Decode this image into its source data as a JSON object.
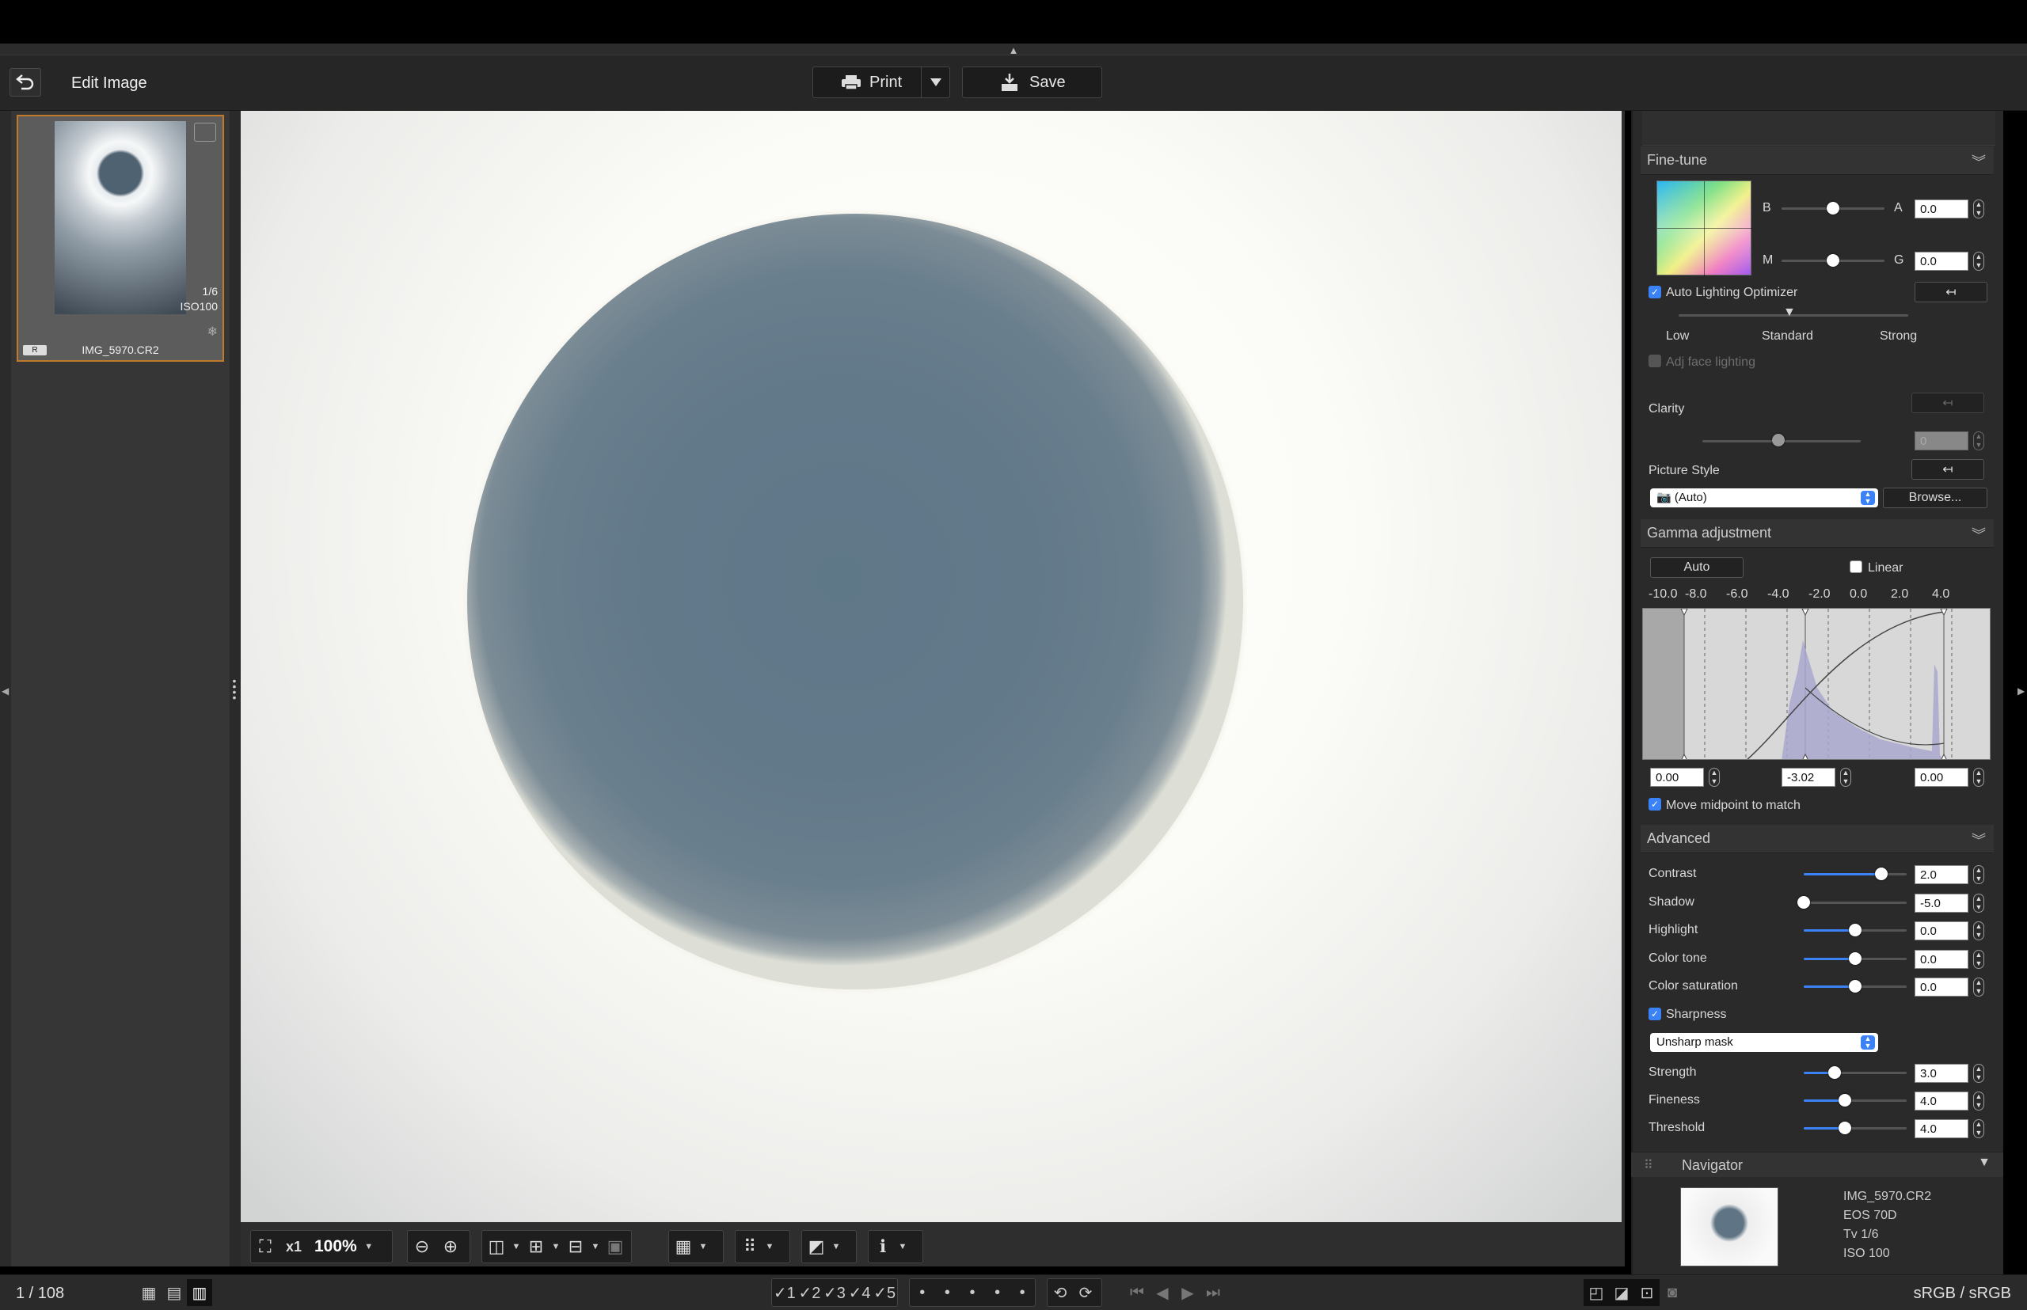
{
  "window": {
    "title": "Edit Image"
  },
  "toolbar": {
    "print_label": "Print",
    "save_label": "Save"
  },
  "thumbnail": {
    "filename": "IMG_5970.CR2",
    "shutter": "1/6",
    "iso": "ISO100",
    "badge": "R"
  },
  "image_toolbar": {
    "zoom": "100%",
    "x1_label": "x1"
  },
  "fine_tune": {
    "header": "Fine-tune",
    "b_label": "B",
    "a_label": "A",
    "a_value": "0.0",
    "m_label": "M",
    "g_label": "G",
    "g_value": "0.0",
    "auto_lighting_label": "Auto Lighting Optimizer",
    "auto_lighting_checked": true,
    "alo_low": "Low",
    "alo_standard": "Standard",
    "alo_strong": "Strong",
    "adj_face_label": "Adj face lighting",
    "clarity_label": "Clarity",
    "clarity_value": "0",
    "picture_style_label": "Picture Style",
    "picture_style_value": "(Auto)",
    "browse_label": "Browse..."
  },
  "gamma": {
    "header": "Gamma adjustment",
    "auto_label": "Auto",
    "linear_label": "Linear",
    "linear_checked": false,
    "ticks": [
      "-10.0",
      "-8.0",
      "-6.0",
      "-4.0",
      "-2.0",
      "0.0",
      "2.0",
      "4.0"
    ],
    "black_value": "0.00",
    "mid_value": "-3.02",
    "white_value": "0.00",
    "move_midpoint_label": "Move midpoint to match",
    "move_midpoint_checked": true
  },
  "advanced": {
    "header": "Advanced",
    "rows": [
      {
        "label": "Contrast",
        "value": "2.0",
        "level": 0.75
      },
      {
        "label": "Shadow",
        "value": "-5.0",
        "level": 0.0
      },
      {
        "label": "Highlight",
        "value": "0.0",
        "level": 0.5
      },
      {
        "label": "Color tone",
        "value": "0.0",
        "level": 0.5
      },
      {
        "label": "Color saturation",
        "value": "0.0",
        "level": 0.5
      }
    ],
    "sharpness_label": "Sharpness",
    "sharpness_checked": true,
    "sharpness_mode": "Unsharp mask",
    "sharp_rows": [
      {
        "label": "Strength",
        "value": "3.0",
        "level": 0.3
      },
      {
        "label": "Fineness",
        "value": "4.0",
        "level": 0.4
      },
      {
        "label": "Threshold",
        "value": "4.0",
        "level": 0.4
      }
    ]
  },
  "navigator": {
    "header": "Navigator",
    "filename": "IMG_5970.CR2",
    "camera": "EOS 70D",
    "tv": "Tv 1/6",
    "iso": "ISO 100"
  },
  "status": {
    "count": "1 / 108",
    "color_space": "sRGB / sRGB"
  },
  "colors": {
    "accent": "#3b82f6",
    "selection": "#c07a2a"
  }
}
